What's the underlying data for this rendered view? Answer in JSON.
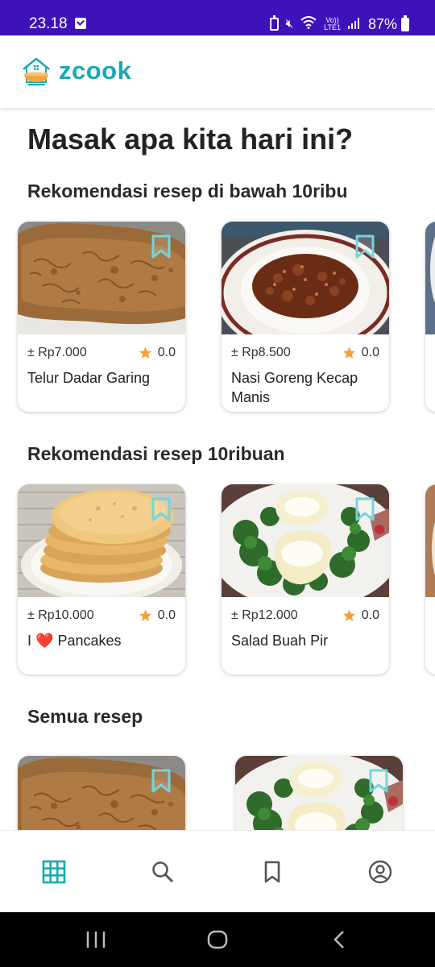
{
  "status_bar": {
    "time": "23.18",
    "battery": "87%",
    "network_top": "Vo))",
    "network_bottom": "LTE1"
  },
  "app": {
    "brand": "zcook",
    "accent_color": "#19aab0",
    "status_color": "#3d12b8"
  },
  "main": {
    "heading": "Masak apa kita hari ini?",
    "sections": [
      {
        "title": "Rekomendasi resep di bawah 10ribu",
        "cards": [
          {
            "price": "± Rp7.000",
            "rating": "0.0",
            "title": "Telur Dadar Garing",
            "image": "omelette"
          },
          {
            "price": "± Rp8.500",
            "rating": "0.0",
            "title": "Nasi Goreng Kecap Manis",
            "image": "fried-rice"
          }
        ]
      },
      {
        "title": "Rekomendasi resep 10ribuan",
        "cards": [
          {
            "price": "± Rp10.000",
            "rating": "0.0",
            "title_prefix": "I",
            "title_heart": "❤️",
            "title": "Pancakes",
            "image": "pancakes"
          },
          {
            "price": "± Rp12.000",
            "rating": "0.0",
            "title": "Salad Buah Pir",
            "image": "pear-salad"
          }
        ]
      },
      {
        "title": "Semua resep",
        "cards": [
          {
            "image": "omelette"
          },
          {
            "image": "pear-salad"
          }
        ]
      }
    ]
  },
  "bottom_nav": {
    "items": [
      {
        "icon": "grid-icon",
        "active": true
      },
      {
        "icon": "search-icon",
        "active": false
      },
      {
        "icon": "bookmark-icon",
        "active": false
      },
      {
        "icon": "account-icon",
        "active": false
      }
    ]
  },
  "system_nav": {
    "buttons": [
      "recents-icon",
      "home-icon",
      "back-icon"
    ]
  }
}
